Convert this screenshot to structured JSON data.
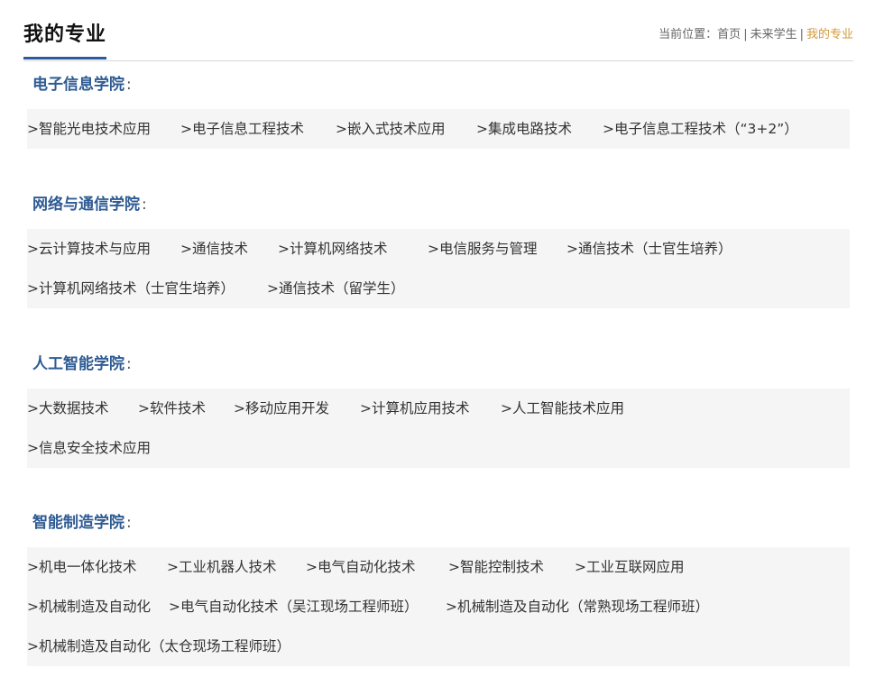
{
  "header": {
    "title": "我的专业",
    "breadcrumb": {
      "prefix": "当前位置：",
      "home": "首页",
      "sep": "|",
      "parent": "未来学生",
      "current": "我的专业"
    }
  },
  "colleges": [
    {
      "name": "电子信息学院",
      "colon": ":",
      "rows": [
        [
          "智能光电技术应用",
          "电子信息工程技术",
          "嵌入式技术应用",
          "集成电路技术",
          "电子信息工程技术（“3+2”）"
        ]
      ]
    },
    {
      "name": "网络与通信学院",
      "colon": ":",
      "rows": [
        [
          "云计算技术与应用",
          "通信技术",
          "计算机网络技术",
          "电信服务与管理",
          "通信技术（士官生培养）"
        ],
        [
          "计算机网络技术（士官生培养）",
          "通信技术（留学生）"
        ]
      ]
    },
    {
      "name": "人工智能学院",
      "colon": ":",
      "rows": [
        [
          "大数据技术",
          "软件技术",
          "移动应用开发",
          "计算机应用技术",
          "人工智能技术应用"
        ],
        [
          "信息安全技术应用"
        ]
      ]
    },
    {
      "name": "智能制造学院",
      "colon": ":",
      "rows": [
        [
          "机电一体化技术",
          "工业机器人技术",
          "电气自动化技术",
          "智能控制技术",
          "工业互联网应用"
        ],
        [
          "机械制造及自动化",
          "电气自动化技术（吴江现场工程师班）",
          "机械制造及自动化（常熟现场工程师班）"
        ],
        [
          "机械制造及自动化（太仓现场工程师班）"
        ]
      ]
    }
  ]
}
